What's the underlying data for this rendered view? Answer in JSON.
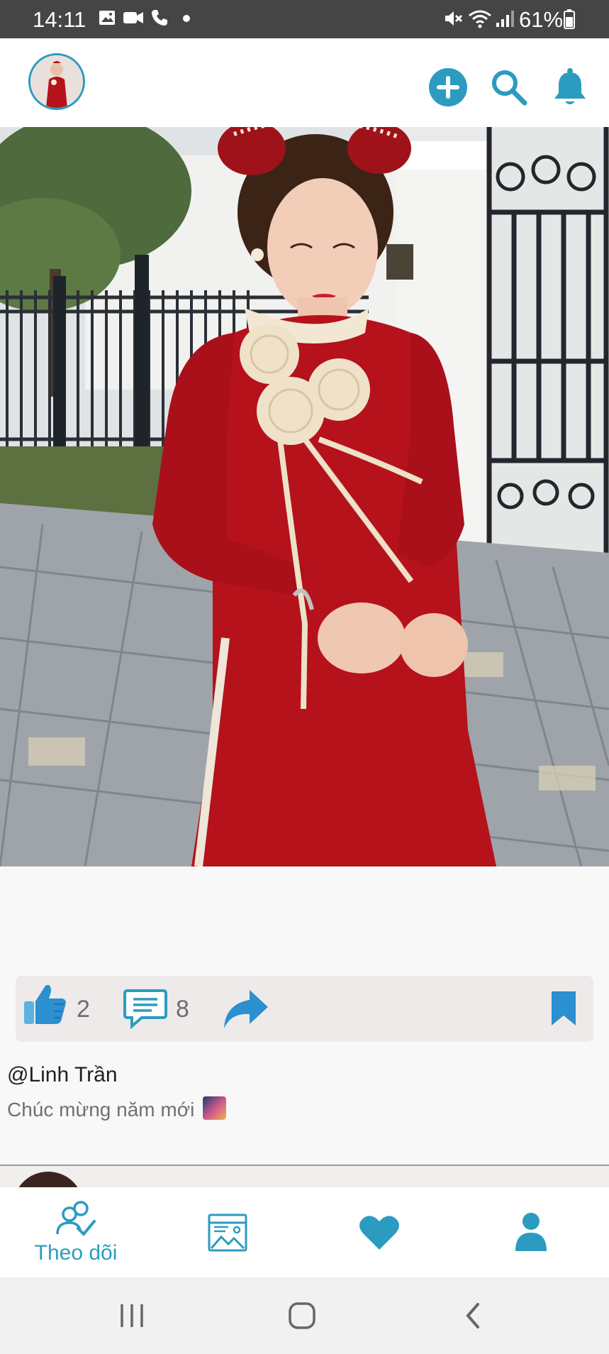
{
  "status_bar": {
    "time": "14:11",
    "battery": "61%",
    "left_icons": [
      "gallery-icon",
      "video-call-icon",
      "phone-icon",
      "dot-icon"
    ],
    "right_icons": [
      "mute-icon",
      "wifi-icon",
      "signal-icon",
      "battery-icon"
    ]
  },
  "header": {
    "icons": [
      "profile-avatar",
      "add-circle-icon",
      "search-icon",
      "bell-icon"
    ]
  },
  "post": {
    "likes": "2",
    "comments": "8",
    "username": "@Linh Trần",
    "caption": "Chúc mừng năm mới"
  },
  "bottom_nav": {
    "items": [
      {
        "label": "Theo dõi",
        "icon": "following-icon",
        "active": true
      },
      {
        "label": "",
        "icon": "gallery-icon"
      },
      {
        "label": "",
        "icon": "heart-icon"
      },
      {
        "label": "",
        "icon": "profile-icon"
      }
    ]
  },
  "colors": {
    "accent": "#2b9cbf",
    "status_bar": "#454545",
    "dress_red": "#b5121b"
  }
}
